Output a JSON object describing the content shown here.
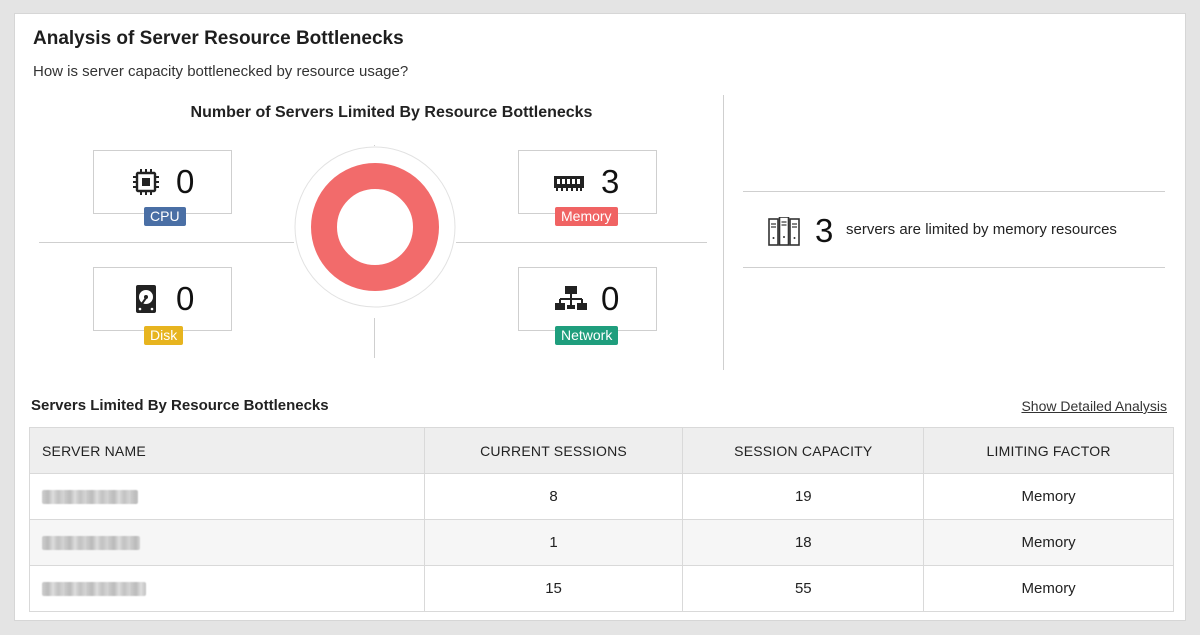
{
  "header": {
    "title": "Analysis of Server Resource Bottlenecks",
    "subtitle": "How is server capacity bottlenecked by resource usage?"
  },
  "panel": {
    "title": "Number of Servers Limited By Resource Bottlenecks",
    "metrics": {
      "cpu": {
        "label": "CPU",
        "value": "0",
        "color": "#4a6fa5",
        "icon": "cpu-icon"
      },
      "memory": {
        "label": "Memory",
        "value": "3",
        "color": "#f06363",
        "icon": "memory-icon"
      },
      "disk": {
        "label": "Disk",
        "value": "0",
        "color": "#e7b41f",
        "icon": "disk-icon"
      },
      "network": {
        "label": "Network",
        "value": "0",
        "color": "#1f9e7d",
        "icon": "network-icon"
      }
    },
    "donut": {
      "memory_share": 1.0,
      "color": "#f26b6b"
    }
  },
  "summary": {
    "count": "3",
    "text": "servers are limited by memory resources",
    "icon": "server-rack-icon"
  },
  "table": {
    "title": "Servers Limited By Resource Bottlenecks",
    "link": "Show Detailed Analysis",
    "columns": [
      "SERVER NAME",
      "CURRENT SESSIONS",
      "SESSION CAPACITY",
      "LIMITING FACTOR"
    ],
    "rows": [
      {
        "current_sessions": "8",
        "session_capacity": "19",
        "limiting_factor": "Memory"
      },
      {
        "current_sessions": "1",
        "session_capacity": "18",
        "limiting_factor": "Memory"
      },
      {
        "current_sessions": "15",
        "session_capacity": "55",
        "limiting_factor": "Memory"
      }
    ]
  }
}
